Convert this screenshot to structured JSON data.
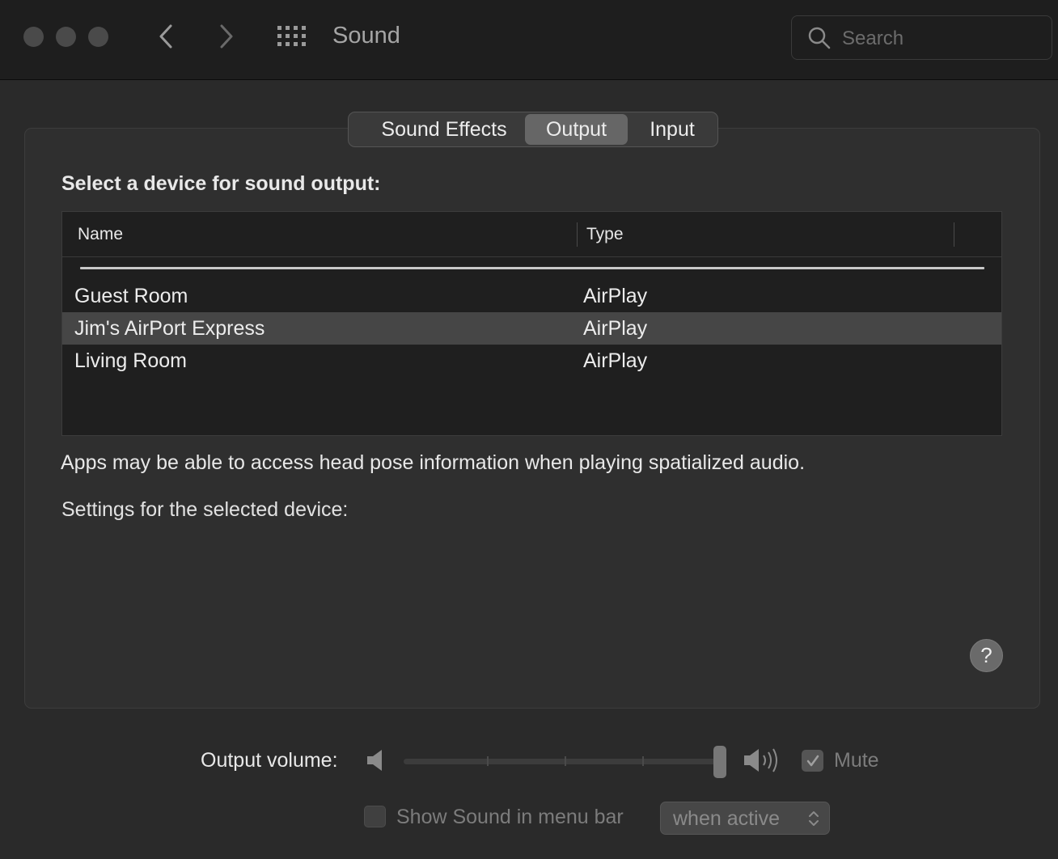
{
  "window": {
    "title": "Sound",
    "search": {
      "placeholder": "Search"
    }
  },
  "tabs": [
    {
      "label": "Sound Effects",
      "active": false
    },
    {
      "label": "Output",
      "active": true
    },
    {
      "label": "Input",
      "active": false
    }
  ],
  "output": {
    "section_label": "Select a device for sound output:",
    "columns": [
      "Name",
      "Type"
    ],
    "devices": [
      {
        "name": "Guest Room",
        "type": "AirPlay",
        "selected": false
      },
      {
        "name": "Jim's AirPort Express",
        "type": "AirPlay",
        "selected": true
      },
      {
        "name": "Living Room",
        "type": "AirPlay",
        "selected": false
      }
    ],
    "info_text": "Apps may be able to access head pose information when playing spatialized audio.",
    "settings_label": "Settings for the selected device:",
    "help_label": "?"
  },
  "volume": {
    "label": "Output volume:",
    "level": 1.0,
    "mute_label": "Mute",
    "mute_checked": true
  },
  "menubar": {
    "label": "Show Sound in menu bar",
    "checked": false,
    "popup_value": "when active"
  },
  "icons": {
    "traffic": [
      "close-icon",
      "minimize-icon",
      "zoom-icon"
    ],
    "back": "chevron-left-icon",
    "forward": "chevron-right-icon",
    "grid": "grid-icon",
    "search": "search-icon",
    "speaker_low": "speaker-low-icon",
    "speaker_high": "speaker-high-icon",
    "popup": "updown-chevron-icon"
  }
}
